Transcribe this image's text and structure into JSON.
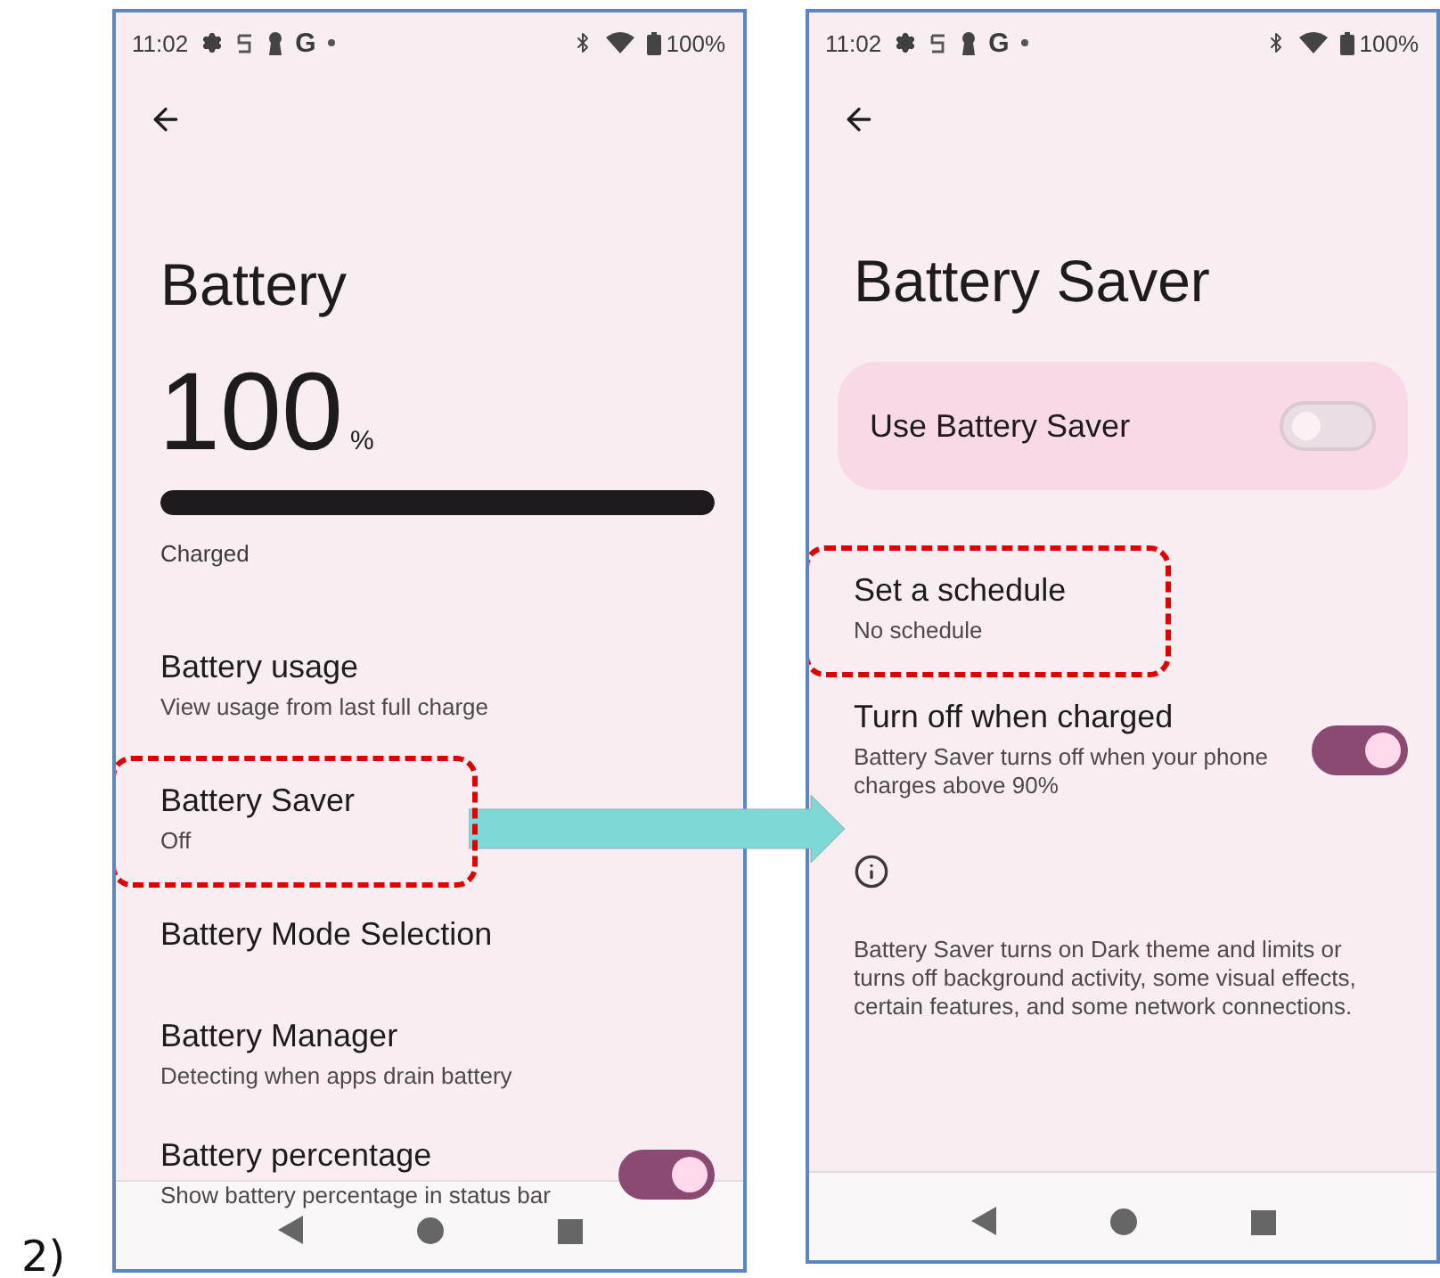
{
  "step_label": "2)",
  "screens": [
    {
      "status_bar": {
        "time": "11:02",
        "notification_letter": "G",
        "battery": "100%"
      },
      "title": "Battery",
      "reading": {
        "value": "100",
        "unit": "%"
      },
      "battery_bar": {
        "level": 1
      },
      "charge_status": "Charged",
      "items": [
        {
          "kind": "entry",
          "title": "Battery usage",
          "subtitle": "View usage from last full charge",
          "highlighted": false
        },
        {
          "kind": "entry",
          "title": "Battery Saver",
          "subtitle": "Off",
          "highlighted": true
        },
        {
          "kind": "entry",
          "title": "Battery Mode Selection",
          "highlighted": false
        },
        {
          "kind": "entry",
          "title": "Battery Manager",
          "subtitle": "Detecting when apps drain battery",
          "highlighted": false
        },
        {
          "kind": "toggle",
          "title": "Battery percentage",
          "subtitle": "Show battery percentage in status bar",
          "on": true,
          "highlighted": false
        }
      ]
    },
    {
      "status_bar": {
        "time": "11:02",
        "notification_letter": "G",
        "battery": "100%"
      },
      "title": "Battery Saver",
      "items": [
        {
          "kind": "card",
          "title": "Use Battery Saver",
          "on": false,
          "highlighted": false
        },
        {
          "kind": "entry",
          "title": "Set a schedule",
          "subtitle": "No schedule",
          "highlighted": true
        },
        {
          "kind": "toggle",
          "title": "Turn off when charged",
          "subtitle": "Battery Saver turns off when your phone charges above 90%",
          "on": true,
          "highlighted": false
        },
        {
          "kind": "info",
          "title": "Battery Saver turns on Dark theme and limits or turns off background activity, some visual effects, certain features, and some network connections.",
          "highlighted": false
        }
      ]
    }
  ]
}
